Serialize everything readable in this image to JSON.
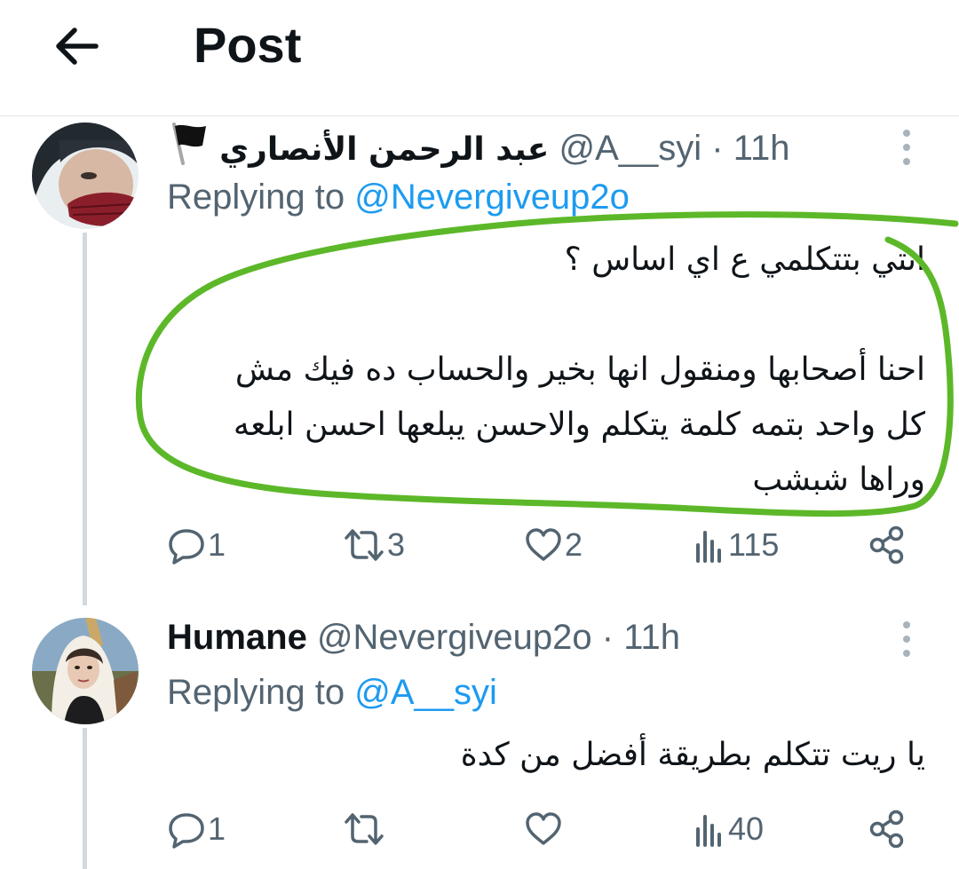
{
  "header": {
    "title": "Post"
  },
  "colors": {
    "accent": "#1d9bf0",
    "muted": "#536471",
    "text": "#0f1419",
    "annotation": "#5cb829"
  },
  "tweets": [
    {
      "name": "عبد الرحمن الأنصاري",
      "flag_icon": "black-flag-icon",
      "handle": "@A__syi",
      "separator": "·",
      "time": "11h",
      "replying_label": "Replying to",
      "replying_to": "@Nevergiveup2o",
      "text_lines": [
        "انتي بتتكلمي ع اي اساس ؟",
        "",
        "احنا أصحابها ومنقول انها بخير والحساب ده فيك مش",
        "كل واحد بتمه كلمة يتكلم والاحسن يبلعها احسن ابلعه",
        "وراها شبشب"
      ],
      "stats": {
        "replies": "1",
        "reposts": "3",
        "likes": "2",
        "views": "115"
      }
    },
    {
      "name": "Humane",
      "handle": "@Nevergiveup2o",
      "separator": "·",
      "time": "11h",
      "replying_label": "Replying to",
      "replying_to": "@A__syi",
      "text_lines": [
        "يا ريت تتكلم بطريقة أفضل من كدة"
      ],
      "stats": {
        "replies": "1",
        "reposts": "",
        "likes": "",
        "views": "40"
      }
    }
  ]
}
